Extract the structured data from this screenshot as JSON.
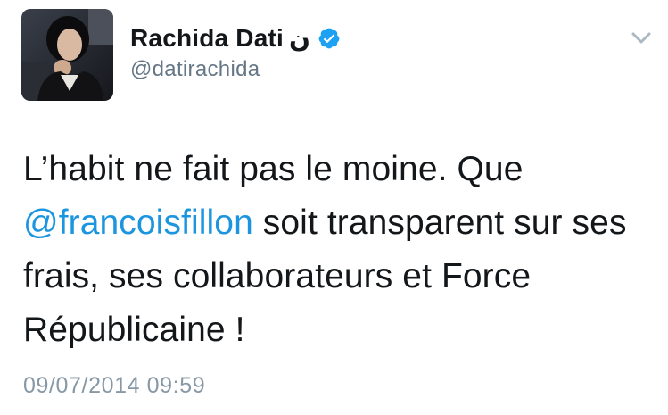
{
  "author": {
    "display_name": "Rachida Dati",
    "name_suffix": "ن",
    "handle": "@datirachida",
    "verified": true
  },
  "tweet": {
    "text_part1": "L’habit ne fait pas le moine. Que",
    "mention": "@francoisfillon",
    "text_part2": " soit transparent sur ses",
    "line3": "frais, ses collaborateurs et Force",
    "line4": "Républicaine !"
  },
  "timestamp": "09/07/2014 09:59",
  "icons": {
    "verified": "verified-badge-icon",
    "menu": "chevron-down-icon"
  },
  "colors": {
    "mention": "#1b95e0",
    "verified": "#1da1f2",
    "secondary_text": "#657786",
    "timestamp": "#8899a6"
  }
}
